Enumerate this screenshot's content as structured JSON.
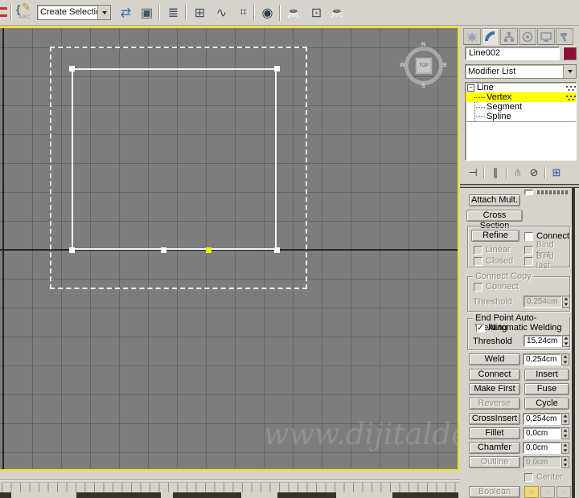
{
  "toolbar": {
    "selection_set_value": "Create Selection Se",
    "icons": {
      "mirror": "⇄",
      "align": "▣",
      "layers": "≣",
      "container": "⊞",
      "curve_editor": "∿",
      "schematic": "⌗",
      "material_editor": "◉",
      "render_setup": "☕",
      "rendered_frame": "⊡",
      "render": "☕"
    }
  },
  "viewport": {
    "viewcube": {
      "top": "TOP",
      "n": "N",
      "s": "S",
      "e": "E",
      "w": "W"
    },
    "watermark": "www.dijitalde"
  },
  "panel": {
    "object_name": "Line002",
    "object_color": "#8e1038",
    "modifier_list": "Modifier List",
    "stack": {
      "line": "Line",
      "vertex": "Vertex",
      "segment": "Segment",
      "spline": "Spline"
    },
    "geometry": {
      "attach_mult": "Attach Mult.",
      "cross_section": "Cross Section",
      "refine": "Refine",
      "connect_checkbox": "Connect",
      "linear": "Linear",
      "closed": "Closed",
      "bind_first": "Bind first",
      "bind_last": "Bind last",
      "connect_copy_title": "Connect Copy",
      "connect_copy_checkbox": "Connect",
      "threshold_label": "Threshold",
      "connect_copy_threshold": "0,254cm",
      "auto_weld_title": "End Point Auto-Welding",
      "automatic_welding": "Automatic Welding",
      "auto_weld_threshold": "15,24cm",
      "weld": "Weld",
      "weld_value": "0,254cm",
      "connect": "Connect",
      "insert": "Insert",
      "make_first": "Make First",
      "fuse": "Fuse",
      "reverse": "Reverse",
      "cycle": "Cycle",
      "cross_insert": "CrossInsert",
      "cross_insert_value": "0,254cm",
      "fillet": "Fillet",
      "fillet_value": "0,0cm",
      "chamfer": "Chamfer",
      "chamfer_value": "0,0cm",
      "outline": "Outline",
      "outline_value": "0,0cm",
      "center": "Center",
      "boolean": "Boolean"
    }
  }
}
